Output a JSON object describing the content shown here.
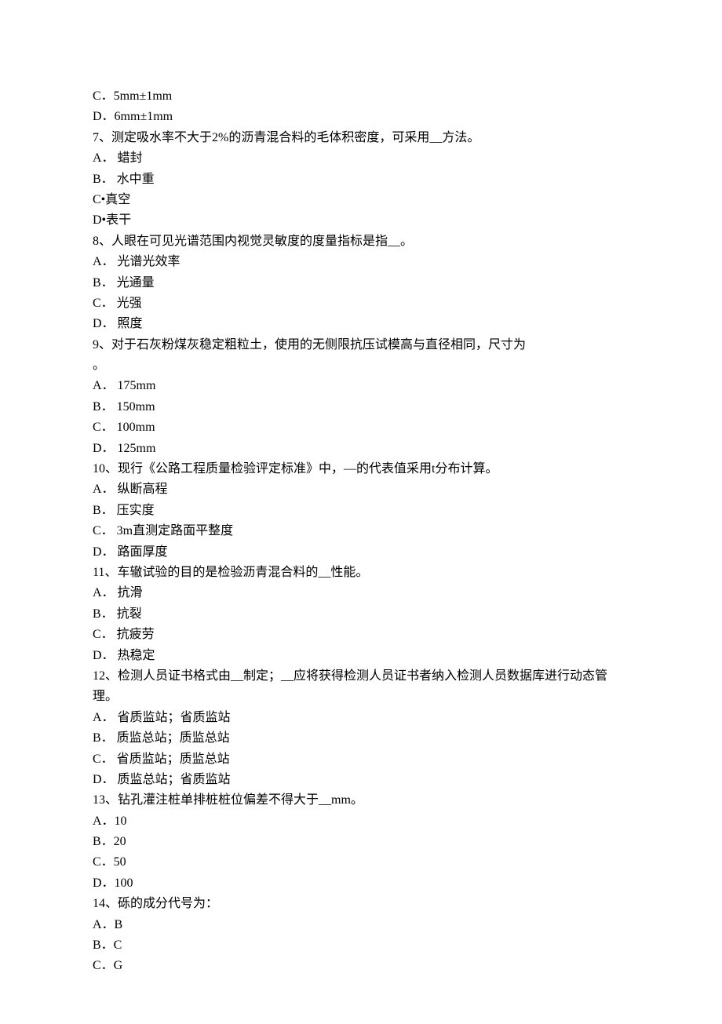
{
  "lines": [
    "C．5mm±1mm",
    "D．6mm±1mm",
    "7、测定吸水率不大于2%的沥青混合料的毛体积密度，可采用__方法。",
    "A． 蜡封",
    "B． 水中重",
    "C•真空",
    "D•表干",
    "8、人眼在可见光谱范围内视觉灵敏度的度量指标是指__。",
    "A． 光谱光效率",
    "B． 光通量",
    "C． 光强",
    "D． 照度",
    "9、对于石灰粉煤灰稳定粗粒土，使用的无侧限抗压试模高与直径相同，尺寸为",
    "。",
    "A． 175mm",
    "B． 150mm",
    "C． 100mm",
    "D． 125mm",
    "10、现行《公路工程质量检验评定标准》中，—的代表值采用t分布计算。",
    "A． 纵断高程",
    "B． 压实度",
    "C． 3m直测定路面平整度",
    "D． 路面厚度",
    "11、车辙试验的目的是检验沥青混合料的__性能。",
    "A． 抗滑",
    "B． 抗裂",
    "C． 抗疲劳",
    "D． 热稳定",
    "12、检测人员证书格式由__制定；__应将获得检测人员证书者纳入检测人员数据库进行动态管理。",
    "A． 省质监站；省质监站",
    "B． 质监总站；质监总站",
    "C． 省质监站；质监总站",
    "D． 质监总站；省质监站",
    "13、钻孔灌注桩单排桩桩位偏差不得大于__mm。",
    "A．10",
    "B．20",
    "C．50",
    "D．100",
    "14、砾的成分代号为：",
    "A．B",
    "B．C",
    "C．G"
  ]
}
